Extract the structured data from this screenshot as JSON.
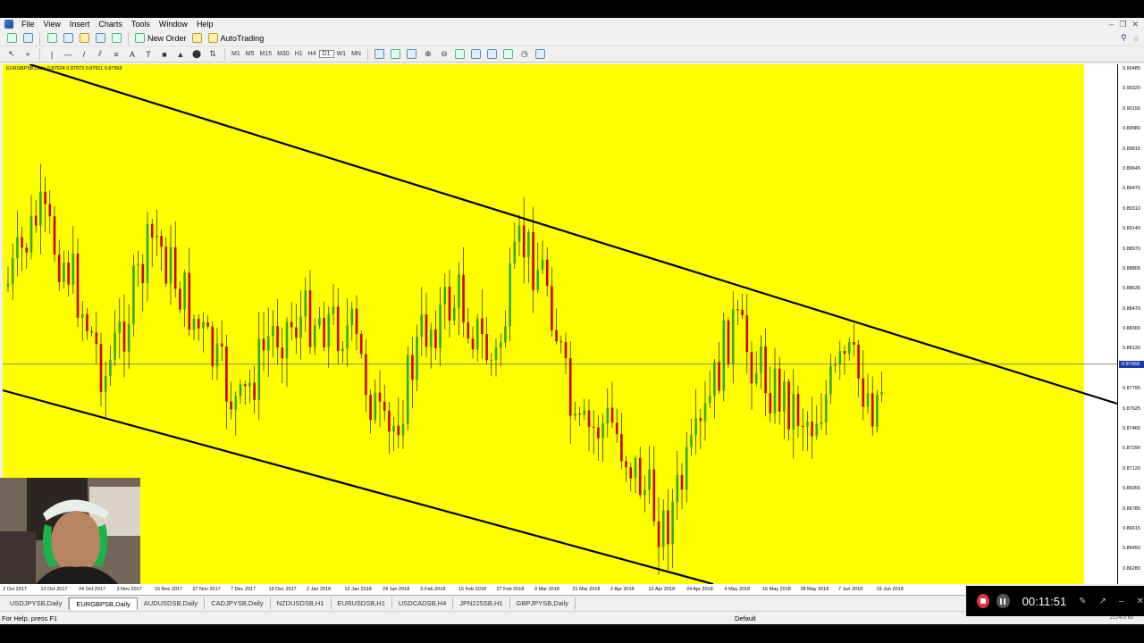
{
  "menu": {
    "items": [
      "File",
      "View",
      "Insert",
      "Charts",
      "Tools",
      "Window",
      "Help"
    ]
  },
  "toolbar": {
    "new_order_label": "New Order",
    "autotrading_label": "AutoTrading",
    "timeframes": [
      "M1",
      "M5",
      "M15",
      "M30",
      "H1",
      "H4",
      "D1",
      "W1",
      "MN"
    ],
    "active_timeframe": "D1"
  },
  "chart": {
    "title": "EURGBPSB,Daily  0.87924 0.87973 0.87911 0.87968",
    "background_color": "#ffff00",
    "bull_color": "#32a82f",
    "bear_color": "#c80000",
    "price_scale": [
      "0.90485",
      "0.90320",
      "0.90150",
      "0.89980",
      "0.89815",
      "0.89645",
      "0.89475",
      "0.89310",
      "0.89140",
      "0.88970",
      "0.88805",
      "0.88635",
      "0.88470",
      "0.88300",
      "0.88130",
      "0.87968",
      "0.87795",
      "0.87625",
      "0.87460",
      "0.87290",
      "0.87120",
      "0.86955",
      "0.86785",
      "0.86615",
      "0.86450",
      "0.86280",
      "0.86115"
    ],
    "current_price": "0.87968",
    "date_labels": [
      "2 Oct 2017",
      "12 Oct 2017",
      "24 Oct 2017",
      "3 Nov 2017",
      "15 Nov 2017",
      "27 Nov 2017",
      "7 Dec 2017",
      "19 Dec 2017",
      "2 Jan 2018",
      "12 Jan 2018",
      "24 Jan 2018",
      "5 Feb 2018",
      "15 Feb 2018",
      "27 Feb 2018",
      "9 Mar 2018",
      "21 Mar 2018",
      "2 Apr 2018",
      "12 Apr 2018",
      "24 Apr 2018",
      "4 May 2018",
      "16 May 2018",
      "28 May 2018",
      "7 Jun 2018",
      "19 Jun 2018"
    ]
  },
  "tabs": [
    {
      "label": "USDJPYSB,Daily",
      "active": false
    },
    {
      "label": "EURGBPSB,Daily",
      "active": true
    },
    {
      "label": "AUDUSDSB,Daily",
      "active": false
    },
    {
      "label": "CADJPYSB,Daily",
      "active": false
    },
    {
      "label": "NZDUSDSB,H1",
      "active": false
    },
    {
      "label": "EURUSDSB,H1",
      "active": false
    },
    {
      "label": "USDCADSB,H4",
      "active": false
    },
    {
      "label": "JPN225SB,H1",
      "active": false
    },
    {
      "label": "GBPJPYSB,Daily",
      "active": false
    }
  ],
  "status": {
    "help": "For Help, press F1",
    "profile": "Default",
    "connection": "2124/3 kb"
  },
  "recorder": {
    "time": "00:11:51"
  }
}
